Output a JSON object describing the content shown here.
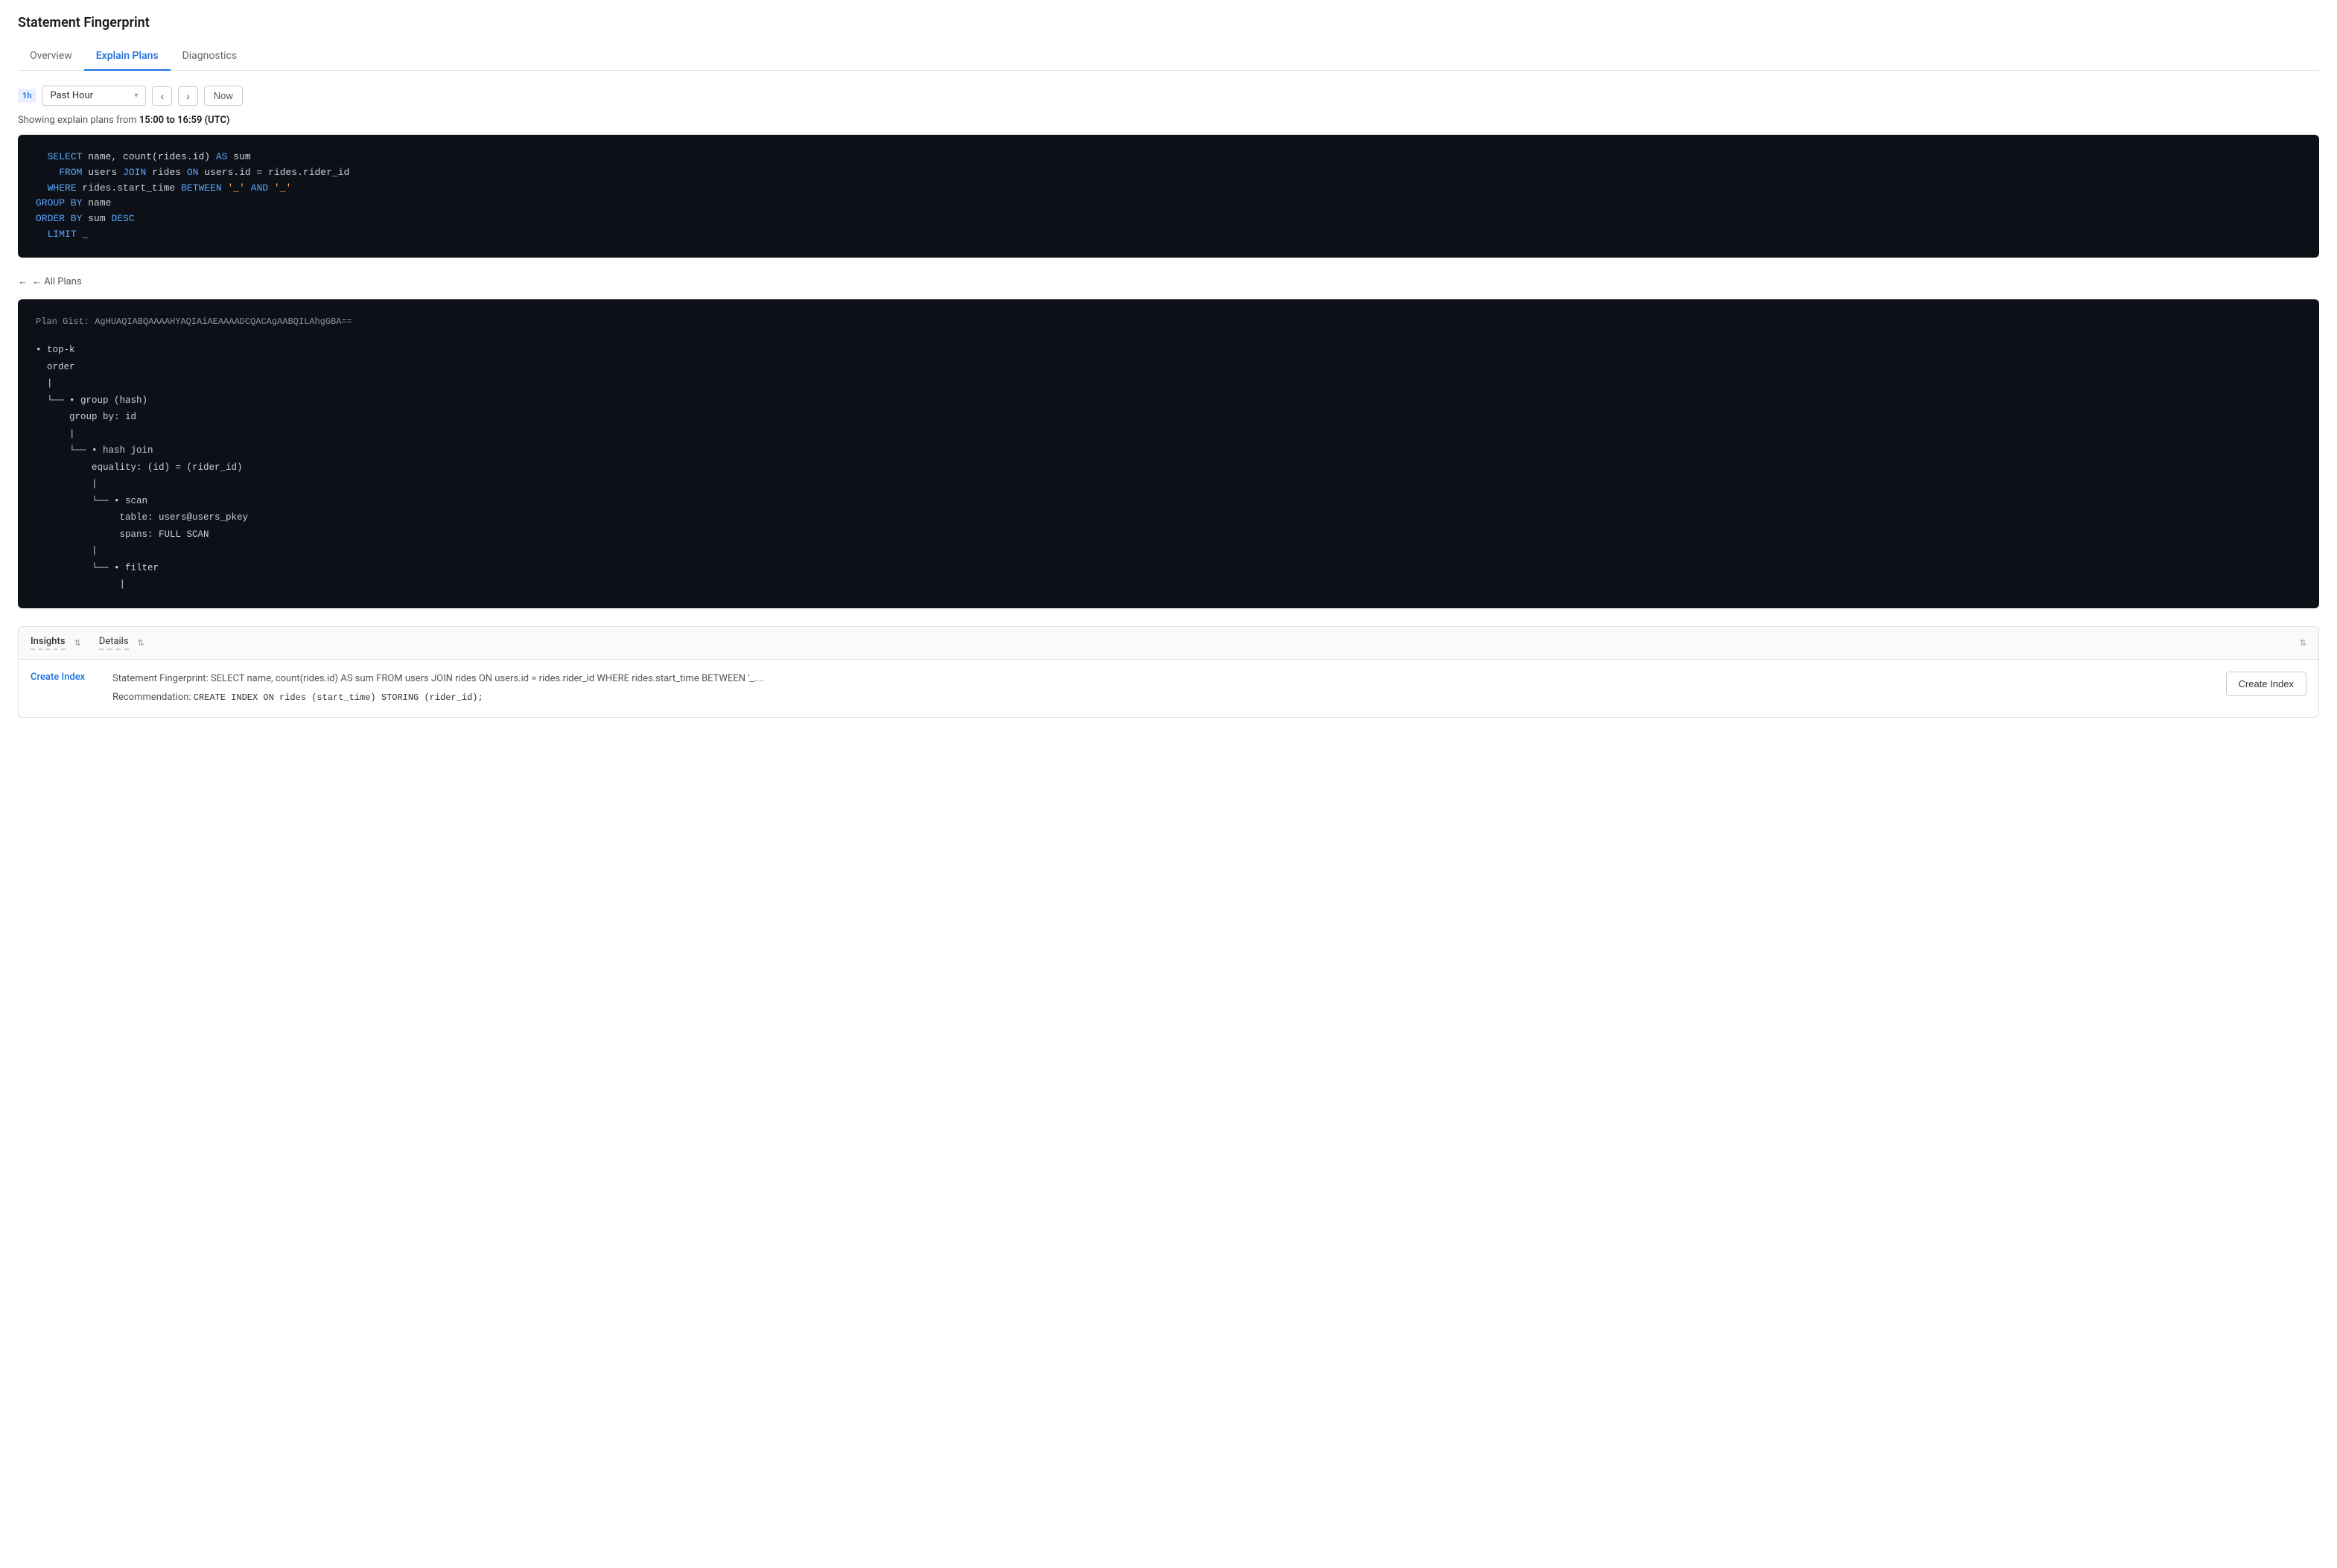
{
  "page": {
    "title": "Statement Fingerprint"
  },
  "tabs": [
    {
      "id": "overview",
      "label": "Overview",
      "active": false
    },
    {
      "id": "explain-plans",
      "label": "Explain Plans",
      "active": true
    },
    {
      "id": "diagnostics",
      "label": "Diagnostics",
      "active": false
    }
  ],
  "toolbar": {
    "time_badge": "1h",
    "time_select_value": "Past Hour",
    "prev_label": "‹",
    "next_label": "›",
    "now_label": "Now"
  },
  "showing_text": {
    "prefix": "Showing explain plans from ",
    "range": "15:00 to 16:59 (UTC)"
  },
  "sql": {
    "line1": "SELECT name, count(rides.id) AS sum",
    "line2": "  FROM users JOIN rides ON users.id = rides.rider_id",
    "line3": "WHERE rides.start_time BETWEEN '_' AND '_'",
    "line4": "GROUP BY name",
    "line5": "ORDER BY sum DESC",
    "line6": "  LIMIT _"
  },
  "back_link": "← All Plans",
  "plan": {
    "gist_label": "Plan Gist:",
    "gist_value": "AgHUAQIABQAAAAHYAQIAiAEAAAADCQACAgAABQILAhgGBA==",
    "nodes": [
      {
        "indent": 0,
        "bullet": true,
        "text": "top-k"
      },
      {
        "indent": 0,
        "bullet": false,
        "text": "order"
      },
      {
        "indent": 0,
        "bullet": false,
        "text": "|"
      },
      {
        "indent": 1,
        "bullet": true,
        "text": "group (hash)"
      },
      {
        "indent": 1,
        "bullet": false,
        "text": "  group by: id"
      },
      {
        "indent": 1,
        "bullet": false,
        "text": "|"
      },
      {
        "indent": 2,
        "bullet": true,
        "text": "hash join"
      },
      {
        "indent": 2,
        "bullet": false,
        "text": "  equality: (id) = (rider_id)"
      },
      {
        "indent": 2,
        "bullet": false,
        "text": "|"
      },
      {
        "indent": 3,
        "bullet": true,
        "text": "scan"
      },
      {
        "indent": 3,
        "bullet": false,
        "text": "    table: users@users_pkey"
      },
      {
        "indent": 3,
        "bullet": false,
        "text": "    spans: FULL SCAN"
      },
      {
        "indent": 2,
        "bullet": false,
        "text": "|"
      },
      {
        "indent": 3,
        "bullet": true,
        "text": "filter"
      },
      {
        "indent": 3,
        "bullet": false,
        "text": "|"
      }
    ]
  },
  "insights_section": {
    "insights_label": "Insights",
    "details_label": "Details",
    "sort_icon": "⇅",
    "row": {
      "type_label": "Create Index",
      "fingerprint_prefix": "Statement Fingerprint:",
      "fingerprint_value": "SELECT name, count(rides.id) AS sum FROM users JOIN rides ON users.id = rides.rider_id WHERE rides.start_time BETWEEN '_....",
      "recommendation_prefix": "Recommendation:",
      "recommendation_value": "CREATE INDEX ON rides (start_time) STORING (rider_id);",
      "button_label": "Create Index"
    }
  }
}
